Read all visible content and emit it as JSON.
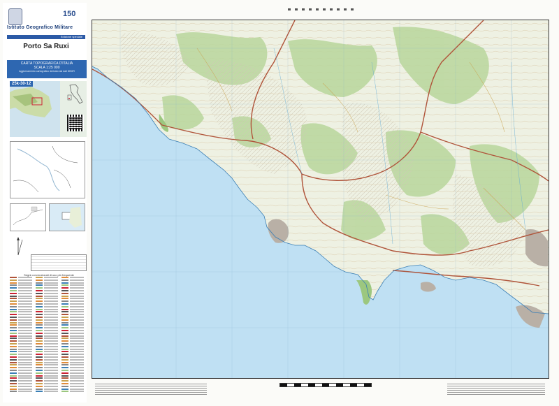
{
  "header": {
    "institute": "Istituto Geografico Militare",
    "anniversary_badge": "150",
    "edition_label": "Edizione speciale"
  },
  "sheet": {
    "title": "Porto Sa Ruxi",
    "code": "25k-30-12",
    "series_line1": "CARTA TOPOGRAFICA D'ITALIA",
    "series_line2": "SCALA 1:25 000",
    "series_line3": "Aggiornamento cartografico derivato dai dati DBGR"
  },
  "legend": {
    "title": "Segni convenzionali di uso più frequente"
  },
  "colors": {
    "sea": "#bfe0f3",
    "land": "#eef1e3",
    "forest": "#b9d69c",
    "road_main": "#b0543a",
    "accent_blue": "#2e67b1",
    "relief": "#c9c3b3"
  },
  "map": {
    "icons": [
      "compass-icon",
      "qr-code-icon",
      "emblem-icon"
    ]
  }
}
